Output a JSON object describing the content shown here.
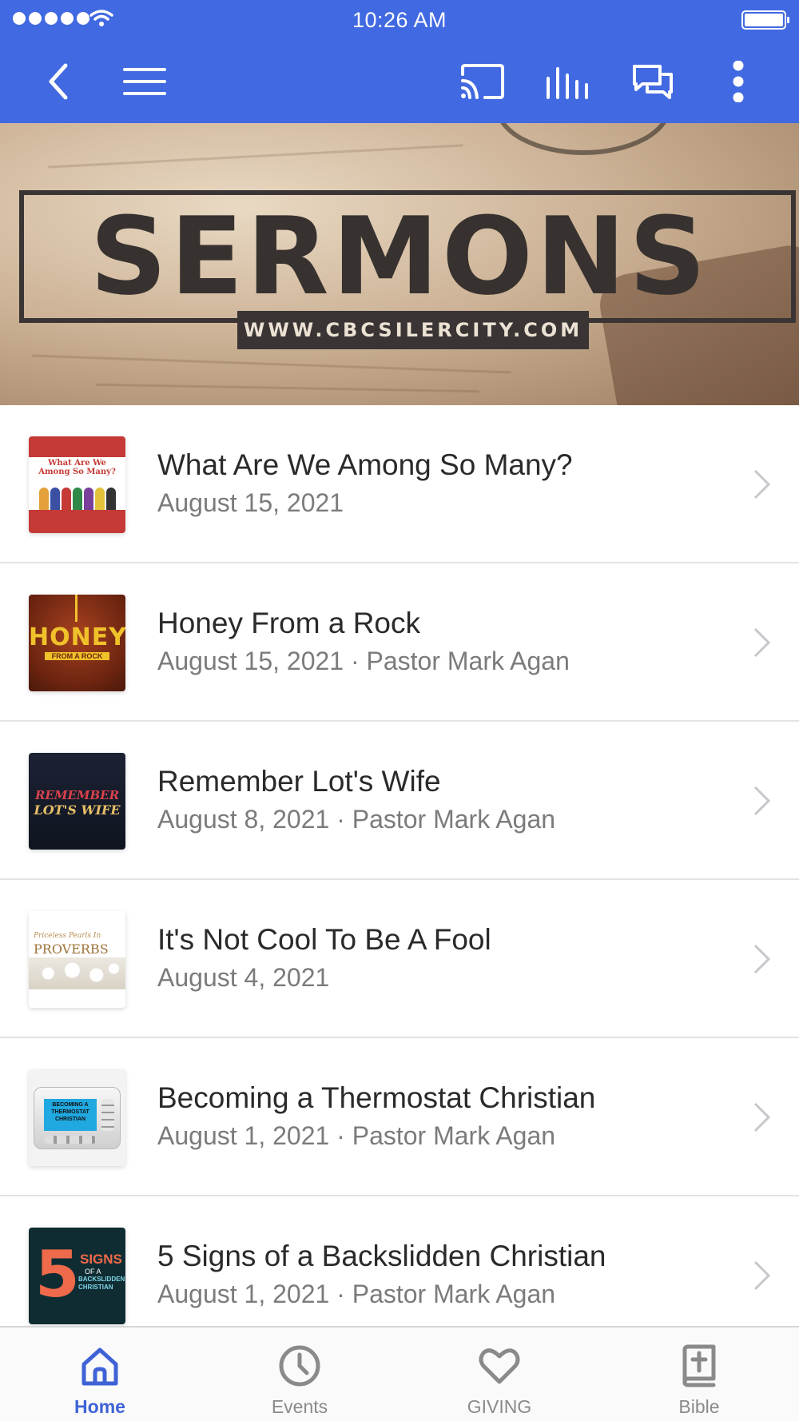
{
  "status_bar": {
    "time": "10:26 AM"
  },
  "nav_bar": {
    "icons": [
      "back-icon",
      "menu-icon",
      "cast-icon",
      "audio-bars-icon",
      "chat-icon",
      "more-icon"
    ],
    "accent_color": "#4169e1"
  },
  "banner": {
    "title": "SERMONS",
    "url": "WWW.CBCSILERCITY.COM"
  },
  "sermons": [
    {
      "title": "What Are We Among So Many?",
      "subtitle": "August 15, 2021",
      "thumb_text": [
        "What Are We",
        "Among So Many?"
      ]
    },
    {
      "title": "Honey From a Rock",
      "subtitle": "August 15, 2021 · Pastor Mark Agan",
      "thumb_text": [
        "HONEY",
        "FROM A ROCK"
      ]
    },
    {
      "title": "Remember Lot's Wife",
      "subtitle": "August 8, 2021 · Pastor Mark Agan",
      "thumb_text": [
        "REMEMBER",
        "LOT'S WIFE"
      ]
    },
    {
      "title": "It's Not Cool To Be A Fool",
      "subtitle": "August 4, 2021",
      "thumb_text": [
        "Priceless Pearls In",
        "PROVERBS"
      ]
    },
    {
      "title": "Becoming a Thermostat Christian",
      "subtitle": "August 1, 2021 · Pastor Mark Agan",
      "thumb_text": [
        "BECOMING A THERMOSTAT CHRISTIAN"
      ]
    },
    {
      "title": "5 Signs of a Backslidden Christian",
      "subtitle": "August 1, 2021 · Pastor Mark Agan",
      "thumb_text": [
        "5",
        "SIGNS",
        "OF A",
        "BACKSLIDDEN CHRISTIAN"
      ]
    }
  ],
  "tab_bar": {
    "tabs": [
      {
        "label": "Home",
        "icon": "home-icon",
        "active": true
      },
      {
        "label": "Events",
        "icon": "clock-icon",
        "active": false
      },
      {
        "label": "GIVING",
        "icon": "heart-icon",
        "active": false
      },
      {
        "label": "Bible",
        "icon": "bible-icon",
        "active": false
      }
    ],
    "active_color": "#3f63d6",
    "inactive_color": "#8a8a8a"
  }
}
